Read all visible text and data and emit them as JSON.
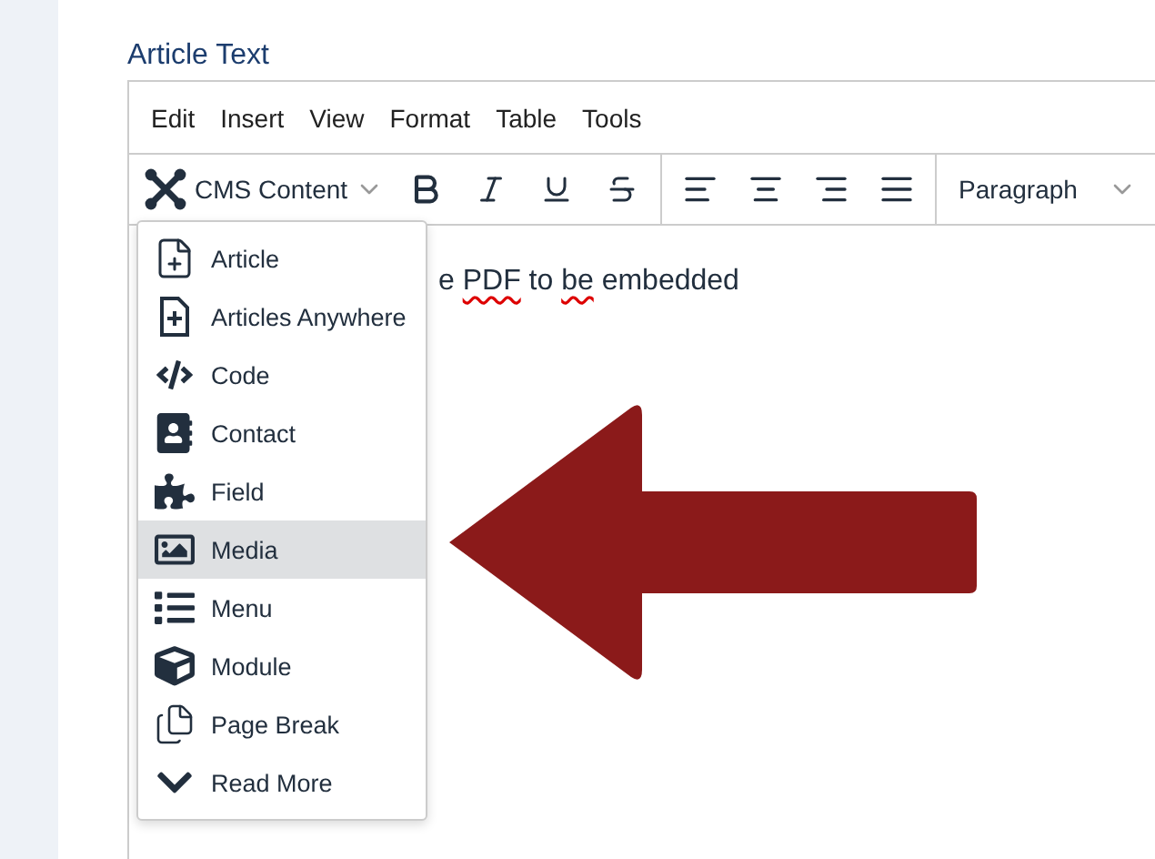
{
  "field_label": "Article Text",
  "menubar": [
    "Edit",
    "Insert",
    "View",
    "Format",
    "Table",
    "Tools"
  ],
  "toolbar": {
    "cms_button": "CMS Content",
    "block_format": "Paragraph"
  },
  "body_text": [
    {
      "text": "e ",
      "misspelled": false
    },
    {
      "text": "PDF",
      "misspelled": true
    },
    {
      "text": " to ",
      "misspelled": false
    },
    {
      "text": "be",
      "misspelled": true
    },
    {
      "text": " embedded",
      "misspelled": false
    }
  ],
  "cms_menu": [
    {
      "label": "Article",
      "selected": false
    },
    {
      "label": "Articles Anywhere",
      "selected": false
    },
    {
      "label": "Code",
      "selected": false
    },
    {
      "label": "Contact",
      "selected": false
    },
    {
      "label": "Field",
      "selected": false
    },
    {
      "label": "Media",
      "selected": true
    },
    {
      "label": "Menu",
      "selected": false
    },
    {
      "label": "Module",
      "selected": false
    },
    {
      "label": "Page Break",
      "selected": false
    },
    {
      "label": "Read More",
      "selected": false
    }
  ]
}
